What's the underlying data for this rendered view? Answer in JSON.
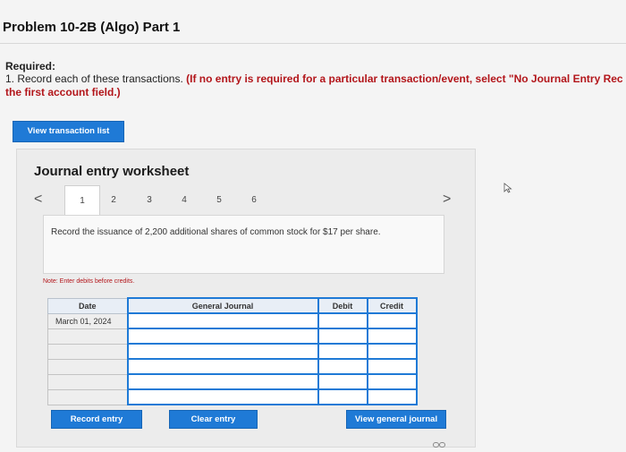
{
  "header": {
    "title": "Problem 10-2B (Algo) Part 1"
  },
  "instructions": {
    "required_label": "Required:",
    "line1_plain": "1. Record each of these transactions. ",
    "line1_red": "(If no entry is required for a particular transaction/event, select \"No Journal Entry Rec",
    "line2_red": "the first account field.)"
  },
  "buttons": {
    "view_transaction_list": "View transaction list",
    "record_entry": "Record entry",
    "clear_entry": "Clear entry",
    "view_general_journal": "View general journal"
  },
  "worksheet": {
    "title": "Journal entry worksheet",
    "tabs": [
      "1",
      "2",
      "3",
      "4",
      "5",
      "6"
    ],
    "active_tab": "1",
    "prev_glyph": "<",
    "next_glyph": ">",
    "transaction_text": "Record the issuance of 2,200 additional shares of common stock for $17 per share.",
    "note": "Note: Enter debits before credits."
  },
  "journal": {
    "headers": {
      "date": "Date",
      "general_journal": "General Journal",
      "debit": "Debit",
      "credit": "Credit"
    },
    "rows": [
      {
        "date": "March 01, 2024",
        "account": "",
        "debit": "",
        "credit": ""
      },
      {
        "date": "",
        "account": "",
        "debit": "",
        "credit": ""
      },
      {
        "date": "",
        "account": "",
        "debit": "",
        "credit": ""
      },
      {
        "date": "",
        "account": "",
        "debit": "",
        "credit": ""
      },
      {
        "date": "",
        "account": "",
        "debit": "",
        "credit": ""
      },
      {
        "date": "",
        "account": "",
        "debit": "",
        "credit": ""
      }
    ]
  },
  "colors": {
    "accent": "#1f7ad6",
    "alert_red": "#b3161b"
  },
  "icons": {
    "cursor": "mouse-pointer-icon",
    "footer": "link-icon"
  }
}
